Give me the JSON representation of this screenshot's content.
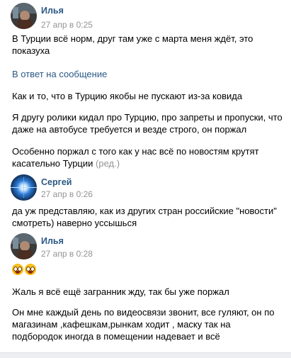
{
  "messages": [
    {
      "author": "Илья",
      "time": "27 апр в 0:25",
      "text1": "В Турции всё норм, друг там уже с марта меня ждёт, это показуха",
      "reply_label": "В ответ на сообщение",
      "text2": "Как и то, что в Турцию якобы не пускают из-за ковида",
      "text3": "Я другу ролики кидал про Турцию, про запреты и пропуски, что даже на автобусе требуется и везде строго, он поржал",
      "text4": "Особенно поржал с того как у нас всё по новостям крутят касательно Турции",
      "edited_label": "(ред.)"
    },
    {
      "author": "Сергей",
      "time": "27 апр в 0:26",
      "text1": "да уж представляю, как из других стран российские \"новости\" смотреть) наверно уссышься"
    },
    {
      "author": "Илья",
      "time": "27 апр в 0:28",
      "emoji": [
        "astonished-face-emoji",
        "astonished-face-emoji"
      ],
      "text1": "Жаль я всё ещё загранник жду, так бы уже поржал",
      "text2": "Он мне каждый день по видеосвязи звонит, все гуляют, он по магазинам ,кафешкам,рынкам ходит , маску так на подбородок иногда в помещении надевает и всё"
    }
  ],
  "colors": {
    "link": "#2a5885",
    "muted": "#939393",
    "background": "#edeef0"
  }
}
